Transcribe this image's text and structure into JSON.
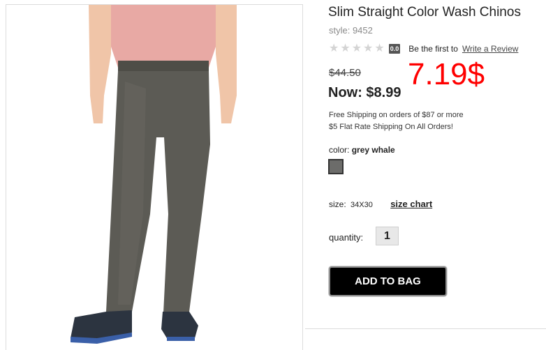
{
  "product": {
    "title": "Slim Straight Color Wash Chinos",
    "style": "style: 9452",
    "rating_score": "0.0",
    "rating_stars": 0,
    "be_first_text": "Be the first to",
    "write_review_label": "Write a Review",
    "old_price": "$44.50",
    "now_price": "Now: $8.99",
    "annotation": "7.19$",
    "shipping_line_1": "Free Shipping on orders of $87 or more",
    "shipping_line_2": "$5 Flat Rate Shipping On All Orders!",
    "color_label": "color:",
    "color_value": "grey whale",
    "size_label": "size:",
    "size_value": "34X30",
    "size_chart_label": "size chart",
    "quantity_label": "quantity:",
    "quantity_value": "1",
    "add_to_bag_label": "ADD TO BAG"
  },
  "colors": {
    "annotation_red": "#ff0000",
    "swatch": "#6c6c6a",
    "button_bg": "#000000"
  }
}
